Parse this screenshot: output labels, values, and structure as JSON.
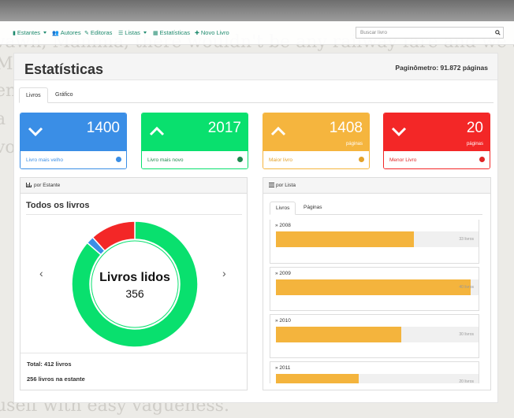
{
  "navbar": {
    "items": [
      {
        "label": "Estantes",
        "icon": "book-icon",
        "caret": true
      },
      {
        "label": "Autores",
        "icon": "users-icon",
        "caret": false
      },
      {
        "label": "Editoras",
        "icon": "edit-icon",
        "caret": false
      },
      {
        "label": "Listas",
        "icon": "list-icon",
        "caret": true
      },
      {
        "label": "Estatísticas",
        "icon": "grid-icon",
        "caret": false
      },
      {
        "label": "Novo Livro",
        "icon": "plus-icon",
        "caret": false
      }
    ],
    "search_placeholder": "Buscar livro"
  },
  "header": {
    "title": "Estatísticas",
    "paginometro": "Paginômetro: 91.872 páginas"
  },
  "tabs": [
    "Livros",
    "Gráfico"
  ],
  "cards": [
    {
      "value": "1400",
      "sub": "",
      "label": "Livro mais velho",
      "chevron": "down",
      "color": "#3a8ee6",
      "label_color": "#3a8ee6"
    },
    {
      "value": "2017",
      "sub": "",
      "label": "Livro mais novo",
      "chevron": "up",
      "color": "#09e06e",
      "label_color": "#1e8a4e"
    },
    {
      "value": "1408",
      "sub": "páginas",
      "label": "Maior livro",
      "chevron": "up",
      "color": "#f5b53e",
      "label_color": "#e3a22a"
    },
    {
      "value": "20",
      "sub": "páginas",
      "label": "Menor Livro",
      "chevron": "down",
      "color": "#f32727",
      "label_color": "#e02525"
    }
  ],
  "estante_panel": {
    "heading": "por Estante",
    "subtitle": "Todos os livros",
    "center_label": "Livros lidos",
    "center_value": "356",
    "total": "Total: 412 livros",
    "na_estante": "256 livros na estante",
    "donut": [
      {
        "name": "Livros lidos",
        "value": 356,
        "color": "#09e06e"
      },
      {
        "name": "",
        "value": 8,
        "color": "#3a8ee6"
      },
      {
        "name": "",
        "value": 48,
        "color": "#f32727"
      }
    ]
  },
  "lista_panel": {
    "heading": "por Lista",
    "tabs": [
      "Livros",
      "Páginas"
    ],
    "bar_color": "#f4b43d",
    "years": [
      {
        "year": "2008",
        "count": "33 livros",
        "fraction": 0.68
      },
      {
        "year": "2009",
        "count": "40 livros",
        "fraction": 0.96
      },
      {
        "year": "2010",
        "count": "30 livros",
        "fraction": 0.62
      },
      {
        "year": "2011",
        "count": "20 livros",
        "fraction": 0.41
      }
    ]
  }
}
